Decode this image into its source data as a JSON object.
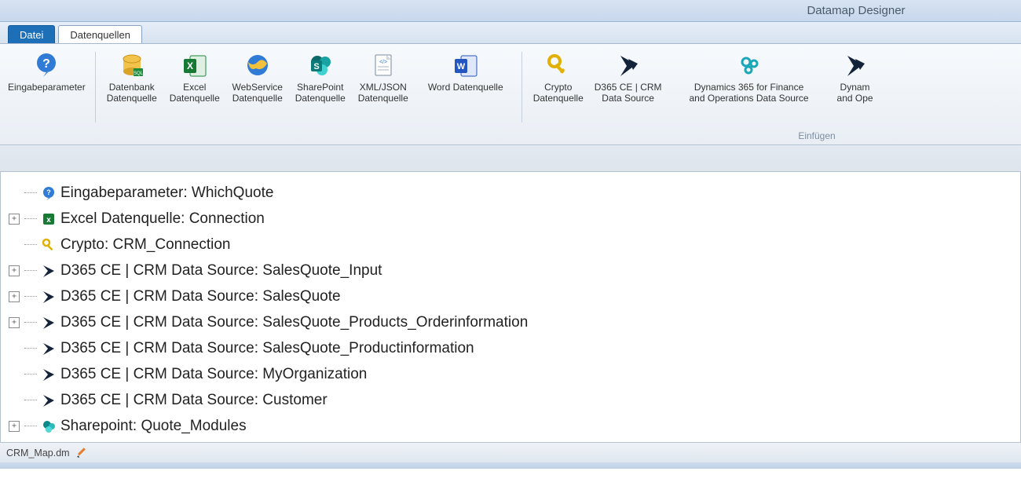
{
  "app": {
    "title": "Datamap Designer"
  },
  "tabs": [
    {
      "label": "Datei",
      "active": false,
      "style": "blue"
    },
    {
      "label": "Datenquellen",
      "active": true,
      "style": "white"
    }
  ],
  "ribbon": {
    "group_caption": "Einfügen",
    "buttons": [
      {
        "icon": "question-bubble",
        "label": "Eingabeparameter"
      },
      {
        "icon": "database",
        "label": "Datenbank\nDatenquelle"
      },
      {
        "icon": "excel",
        "label": "Excel\nDatenquelle"
      },
      {
        "icon": "globe",
        "label": "WebService\nDatenquelle"
      },
      {
        "icon": "sharepoint",
        "label": "SharePoint\nDatenquelle"
      },
      {
        "icon": "xml-page",
        "label": "XML/JSON\nDatenquelle"
      },
      {
        "icon": "word",
        "label": "Word Datenquelle"
      },
      {
        "icon": "key",
        "label": "Crypto\nDatenquelle"
      },
      {
        "icon": "dynamics",
        "label": "D365 CE | CRM\nData Source"
      },
      {
        "icon": "gears-teal",
        "label": "Dynamics 365 for Finance\nand Operations Data Source"
      },
      {
        "icon": "dynamics",
        "label": "Dynam\nand Ope"
      }
    ]
  },
  "tree": [
    {
      "expander": "none",
      "icon": "question-bubble-sm",
      "label": "Eingabeparameter: WhichQuote"
    },
    {
      "expander": "plus",
      "icon": "excel-sm",
      "label": "Excel Datenquelle: Connection"
    },
    {
      "expander": "none",
      "icon": "key-sm",
      "label": "Crypto: CRM_Connection"
    },
    {
      "expander": "plus",
      "icon": "dynamics-sm",
      "label": "D365 CE | CRM Data Source: SalesQuote_Input"
    },
    {
      "expander": "plus",
      "icon": "dynamics-sm",
      "label": "D365 CE | CRM Data Source: SalesQuote"
    },
    {
      "expander": "plus",
      "icon": "dynamics-sm",
      "label": "D365 CE | CRM Data Source: SalesQuote_Products_Orderinformation"
    },
    {
      "expander": "none",
      "icon": "dynamics-sm",
      "label": "D365 CE | CRM Data Source: SalesQuote_Productinformation"
    },
    {
      "expander": "none",
      "icon": "dynamics-sm",
      "label": "D365 CE | CRM Data Source: MyOrganization"
    },
    {
      "expander": "none",
      "icon": "dynamics-sm",
      "label": "D365 CE | CRM Data Source: Customer"
    },
    {
      "expander": "plus",
      "icon": "sharepoint-sm",
      "label": "Sharepoint: Quote_Modules"
    }
  ],
  "footer": {
    "filename": "CRM_Map.dm"
  }
}
